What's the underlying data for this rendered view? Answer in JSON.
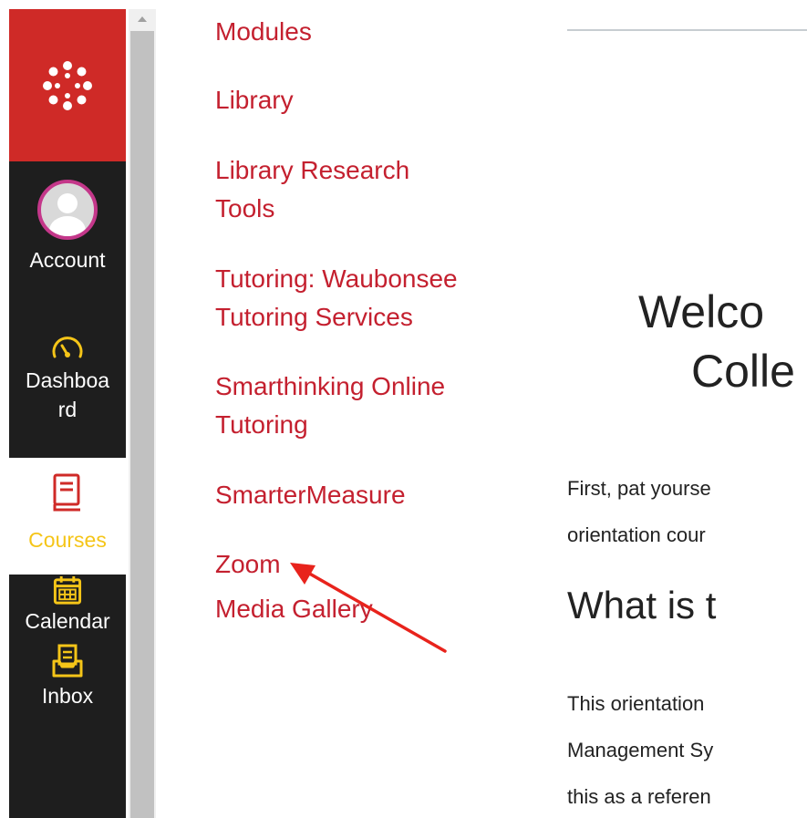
{
  "global_nav": {
    "account_label": "Account",
    "dashboard_label": "Dashboa rd",
    "courses_label": "Courses",
    "calendar_label": "Calendar",
    "inbox_label": "Inbox"
  },
  "course_nav": {
    "modules": "Modules",
    "library": "Library",
    "library_research_1": "Library Research",
    "library_research_2": "Tools",
    "tutoring_1": "Tutoring: Waubonsee",
    "tutoring_2": "Tutoring Services",
    "smarthinking_1": "Smarthinking Online",
    "smarthinking_2": "Tutoring",
    "smartermeasure": "SmarterMeasure",
    "zoom": "Zoom",
    "media_gallery": "Media Gallery"
  },
  "content": {
    "heading_line1": "Welco",
    "heading_line2": "Colle",
    "intro_line1": "First, pat yourse",
    "intro_line2": "orientation cour",
    "subheading": "What is t",
    "body_line1": "This orientation",
    "body_line2": "Management Sy",
    "body_line3": "this as a referen"
  },
  "colors": {
    "brand_red": "#cf2a27",
    "nav_dark": "#1e1e1e",
    "link_red": "#c4202f",
    "active_yellow": "#f5c518",
    "annotation_arrow": "#e8231c"
  }
}
